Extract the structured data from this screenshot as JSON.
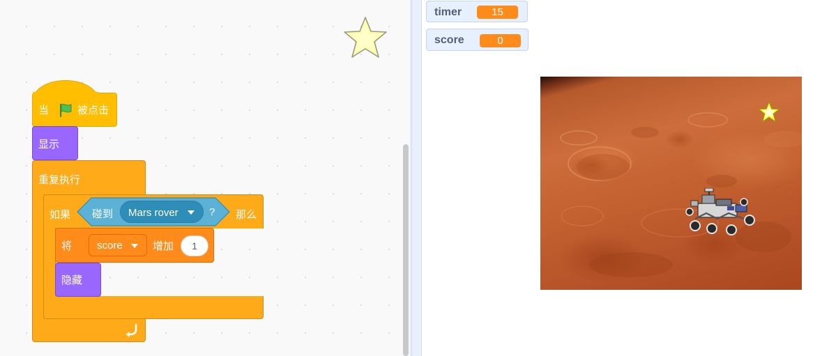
{
  "code_area": {
    "hat_block": {
      "when_label": "当",
      "flag_icon": "green-flag-icon",
      "clicked_label": "被点击"
    },
    "show_block": {
      "label": "显示"
    },
    "forever_block": {
      "label": "重复执行",
      "loop_icon": "loop-arrow-icon"
    },
    "if_block": {
      "if_label": "如果",
      "then_label": "那么"
    },
    "touching_block": {
      "label": "碰到",
      "target": "Mars rover",
      "question_mark": "?"
    },
    "change_block": {
      "label": "将",
      "variable": "score",
      "by_label": "增加",
      "amount": "1"
    },
    "hide_block": {
      "label": "隐藏"
    },
    "sprite_thumbnail": "star-sprite-icon"
  },
  "stage": {
    "monitors": [
      {
        "name": "timer",
        "value": "15"
      },
      {
        "name": "score",
        "value": "0"
      }
    ],
    "backdrop": "mars-surface",
    "sprites": [
      "star-sprite",
      "mars-rover-sprite"
    ]
  },
  "colors": {
    "events": "#ffbf00",
    "looks": "#9966ff",
    "control": "#ffab19",
    "sensing": "#5cb1d6",
    "variables": "#ff8c1a",
    "monitor_bg": "#e6f0ff"
  }
}
